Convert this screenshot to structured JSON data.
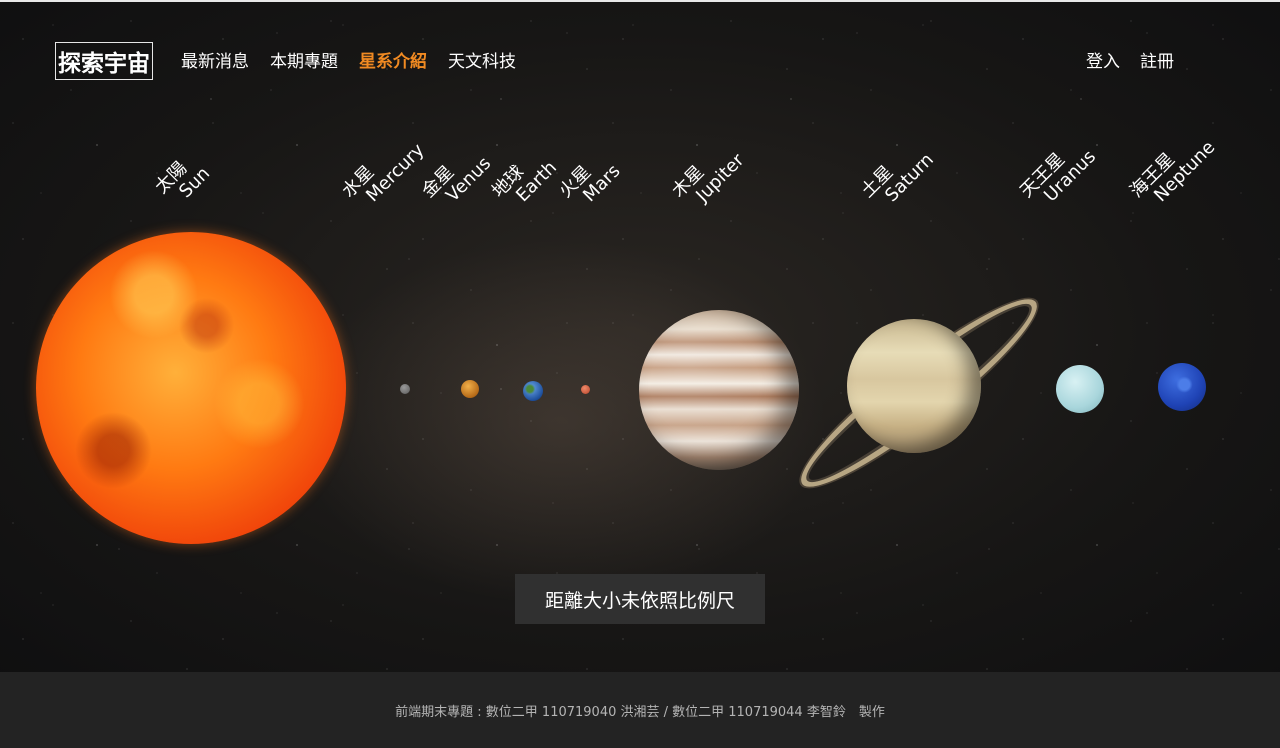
{
  "header": {
    "logo": "探索宇宙",
    "nav": [
      {
        "label": "最新消息"
      },
      {
        "label": "本期專題"
      },
      {
        "label": "星系介紹"
      },
      {
        "label": "天文科技"
      }
    ],
    "active_nav": "星系介紹",
    "accent_color": "#f08a22",
    "login": "登入",
    "register": "註冊"
  },
  "planets": [
    {
      "zh": "太陽",
      "en": "Sun"
    },
    {
      "zh": "水星",
      "en": "Mercury"
    },
    {
      "zh": "金星",
      "en": "Venus"
    },
    {
      "zh": "地球",
      "en": "Earth"
    },
    {
      "zh": "火星",
      "en": "Mars"
    },
    {
      "zh": "木星",
      "en": "Jupiter"
    },
    {
      "zh": "土星",
      "en": "Saturn"
    },
    {
      "zh": "天王星",
      "en": "Uranus"
    },
    {
      "zh": "海王星",
      "en": "Neptune"
    }
  ],
  "note": "距離大小未依照比例尺",
  "footer": "前端期末專題 : 數位二甲 110719040 洪湘芸 / 數位二甲 110719044 李智鈴　製作"
}
